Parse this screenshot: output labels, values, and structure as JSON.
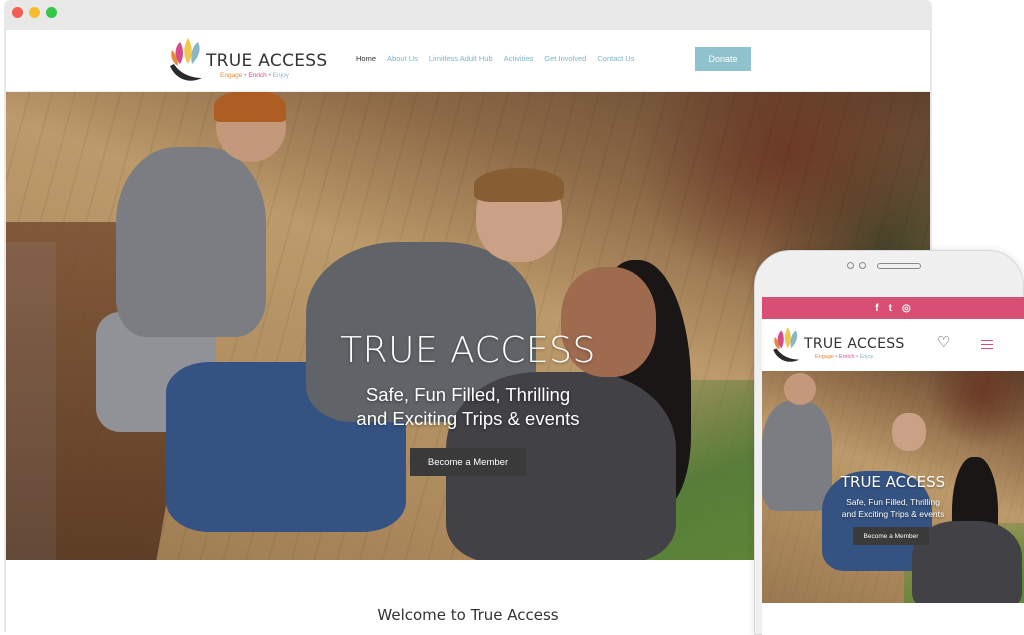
{
  "desktop": {
    "logo": {
      "title": "TRUE ACCESS",
      "tagline": [
        "Engage",
        "Enrich",
        "Enjoy"
      ],
      "tagline_separator": "•"
    },
    "nav": [
      {
        "label": "Home",
        "active": true
      },
      {
        "label": "About Us",
        "active": false
      },
      {
        "label": "Limitless Adult Hub",
        "active": false
      },
      {
        "label": "Activities",
        "active": false
      },
      {
        "label": "Get Involved",
        "active": false
      },
      {
        "label": "Contact Us",
        "active": false
      }
    ],
    "donate_label": "Donate",
    "hero": {
      "title": "TRUE ACCESS",
      "subtitle_line1": "Safe, Fun Filled, Thrilling",
      "subtitle_line2": "and Exciting Trips & events",
      "cta_label": "Become a Member"
    },
    "welcome_heading": "Welcome to True Access"
  },
  "mobile": {
    "social_icons": [
      "facebook-icon",
      "twitter-icon",
      "instagram-icon"
    ],
    "social_glyphs": [
      "f",
      "t",
      "◎"
    ],
    "logo": {
      "title": "TRUE ACCESS",
      "tagline": [
        "Engage",
        "Enrich",
        "Enjoy"
      ],
      "tagline_separator": "•"
    },
    "heart_glyph": "♡",
    "hero": {
      "title": "TRUE ACCESS",
      "subtitle_line1": "Safe, Fun Filled, Thrilling",
      "subtitle_line2": "and Exciting Trips & events",
      "cta_label": "Become a Member"
    }
  },
  "colors": {
    "nav_link": "#7db4c6",
    "donate_bg": "#8fc2cc",
    "social_bar": "#d94f73",
    "cta_bg": "#3a3a3a"
  }
}
